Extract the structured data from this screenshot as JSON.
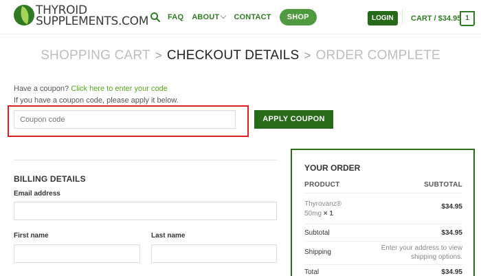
{
  "header": {
    "logo_line1": "THYROID",
    "logo_line2": "SUPPLEMENTS.COM",
    "nav": {
      "faq": "FAQ",
      "about": "ABOUT",
      "contact": "CONTACT",
      "shop": "SHOP"
    },
    "login": "LOGIN",
    "cart_label": "CART / $34.95",
    "cart_count": "1",
    "accent_color": "#2f7a22"
  },
  "steps": {
    "step1": "SHOPPING CART",
    "step2": "CHECKOUT DETAILS",
    "step3": "ORDER COMPLETE",
    "separator": ">"
  },
  "coupon": {
    "prompt": "Have a coupon?",
    "link": "Click here to enter your code",
    "instruction": "If you have a coupon code, please apply it below.",
    "placeholder": "Coupon code",
    "apply": "APPLY COUPON"
  },
  "billing": {
    "title": "BILLING DETAILS",
    "email_label": "Email address",
    "first_name_label": "First name",
    "last_name_label": "Last name"
  },
  "order": {
    "title": "YOUR ORDER",
    "col_product": "PRODUCT",
    "col_subtotal": "SUBTOTAL",
    "item_name_1": "Thyrovanz®",
    "item_name_2": "50mg",
    "item_qty": "× 1",
    "item_price": "$34.95",
    "subtotal_label": "Subtotal",
    "subtotal_value": "$34.95",
    "shipping_label": "Shipping",
    "shipping_note_1": "Enter your address to view",
    "shipping_note_2": "shipping options.",
    "total_label": "Total",
    "total_value": "$34.95"
  }
}
